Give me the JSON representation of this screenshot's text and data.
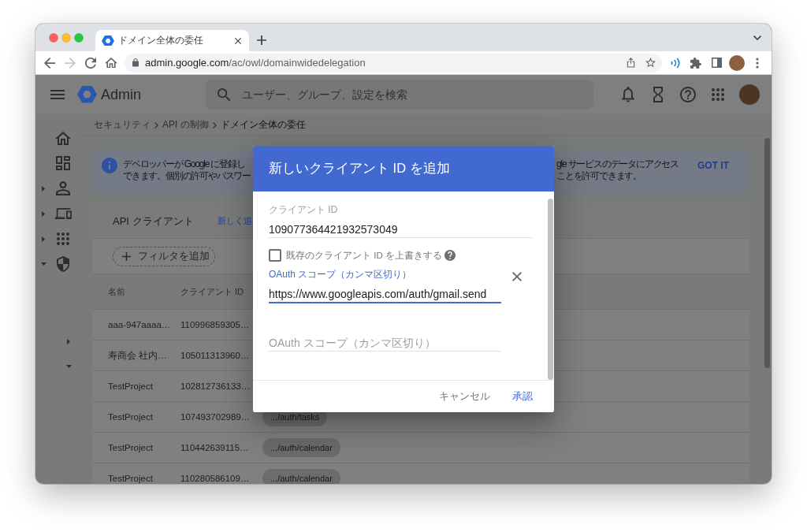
{
  "browser": {
    "tabs": [
      {
        "title": "ドメイン全体の委任",
        "selected": true
      }
    ],
    "navigation": [
      {
        "kind": "back",
        "disabled": false
      },
      {
        "kind": "forward",
        "disabled": true
      },
      {
        "kind": "reload",
        "disabled": false
      },
      {
        "kind": "home",
        "disabled": false
      }
    ],
    "address": {
      "host": "admin.google.com",
      "path": "/ac/owl/domainwidedelegation"
    }
  },
  "header": {
    "product": "Admin",
    "search": {
      "placeholder": "ユーザー、グループ、設定を検索"
    }
  },
  "sidebar": {
    "items": [
      {
        "kind": "home"
      },
      {
        "kind": "dashboard"
      },
      {
        "kind": "users",
        "expanded": false
      },
      {
        "kind": "devices",
        "expanded": false
      },
      {
        "kind": "apps",
        "expanded": false
      },
      {
        "kind": "security",
        "expanded": true,
        "children": [
          {
            "expanded": false
          },
          {
            "expanded": true
          }
        ]
      }
    ]
  },
  "breadcrumb": [
    {
      "label": "セキュリティ",
      "current": false
    },
    {
      "label": "API の制御",
      "current": false
    },
    {
      "label": "ドメイン全体の委任",
      "current": true
    }
  ],
  "banner": {
    "fragments": [
      {
        "lines": [
          "デベロッパーが Google に登録し",
          "できます。個別の許可やパスワー"
        ]
      },
      {
        "lines": [
          "gle サービスのデータにアクセス",
          "ことを許可できます。"
        ]
      }
    ],
    "action": "GOT IT"
  },
  "clients": {
    "title": "API クライアント",
    "action": "新しく追",
    "filter": "フィルタを追加",
    "columns": [
      "名前",
      "クライアント ID"
    ],
    "rows": [
      {
        "name": "aaa-947aaaa…",
        "client_id": "110996859305…"
      },
      {
        "name": "寿商会 社内…",
        "client_id": "105011313960…"
      },
      {
        "name": "TestProject",
        "client_id": "102812736133…"
      },
      {
        "name": "TestProject",
        "client_id": "107493702989…",
        "scope": ".../auth/tasks"
      },
      {
        "name": "TestProject",
        "client_id": "110442639115…",
        "scope": ".../auth/calendar"
      },
      {
        "name": "TestProject",
        "client_id": "110280586109…",
        "scope": ".../auth/calendar"
      }
    ]
  },
  "dialog": {
    "title": "新しいクライアント ID を追加",
    "client_id": {
      "label": "クライアント ID",
      "value": "109077364421932573049"
    },
    "overwrite": {
      "label": "既存のクライアント ID を上書きする",
      "checked": false
    },
    "scopes": [
      {
        "label": "OAuth スコープ（カンマ区切り）",
        "value": "https://www.googleapis.com/auth/gmail.send",
        "focused": true
      },
      {
        "placeholder": "OAuth スコープ（カンマ区切り）",
        "focused": false
      }
    ],
    "buttons": [
      {
        "label": "キャンセル",
        "kind": "cancel"
      },
      {
        "label": "承認",
        "kind": "confirm"
      }
    ]
  }
}
